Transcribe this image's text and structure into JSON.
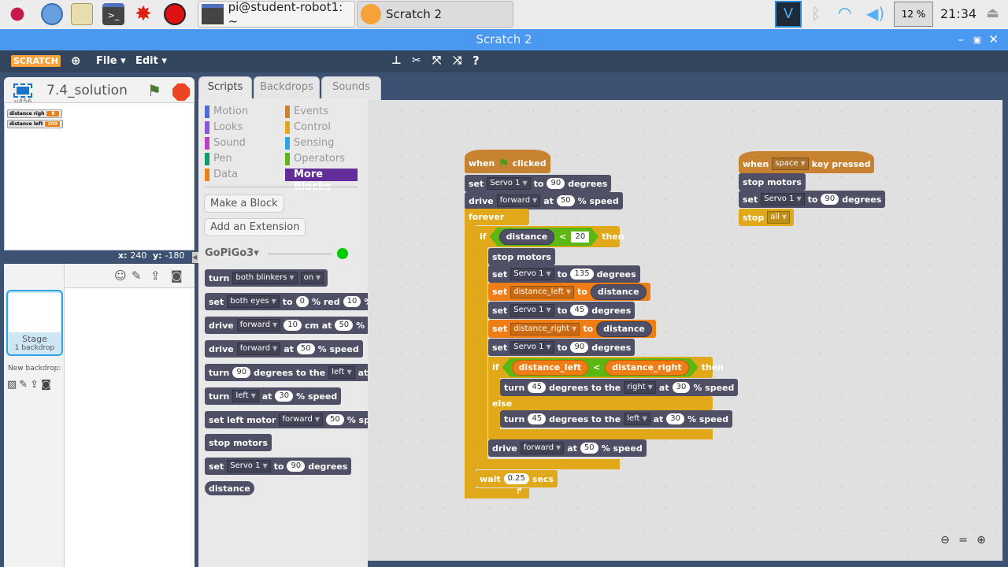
{
  "taskbar": {
    "launchers": [
      "raspberry-menu",
      "web-browser",
      "file-manager",
      "terminal",
      "mathematica",
      "wolfram"
    ],
    "tasks": [
      {
        "label": "pi@student-robot1: ~",
        "icon": "terminal-icon"
      },
      {
        "label": "Scratch 2",
        "icon": "scratch-cat-icon"
      }
    ],
    "cpu": "12 %",
    "clock": "21:34"
  },
  "window": {
    "title": "Scratch 2"
  },
  "menu": {
    "logo": "SCRATCH",
    "file": "File",
    "edit": "Edit"
  },
  "stage": {
    "project_title": "7.4_solution",
    "version": "v456",
    "monitors": [
      {
        "label": "distance righ",
        "value": "8"
      },
      {
        "label": "distance left",
        "value": "300"
      }
    ],
    "x_label": "x:",
    "x": "240",
    "y_label": "y:",
    "y": "-180"
  },
  "sprites": {
    "stage_label": "Stage",
    "backdrop_count": "1 backdrop",
    "new_backdrop": "New backdrop:"
  },
  "tabs": [
    "Scripts",
    "Backdrops",
    "Sounds"
  ],
  "categories": {
    "left": [
      {
        "label": "Motion",
        "color": "#4a6cd4"
      },
      {
        "label": "Looks",
        "color": "#8a55d7"
      },
      {
        "label": "Sound",
        "color": "#bb42c3"
      },
      {
        "label": "Pen",
        "color": "#0e9a6c"
      },
      {
        "label": "Data",
        "color": "#ee7d16"
      }
    ],
    "right": [
      {
        "label": "Events",
        "color": "#c88330"
      },
      {
        "label": "Control",
        "color": "#e1a91a"
      },
      {
        "label": "Sensing",
        "color": "#2ca5e2"
      },
      {
        "label": "Operators",
        "color": "#5cb712"
      },
      {
        "label": "More Blocks",
        "color": "#632d99",
        "selected": true
      }
    ]
  },
  "palette": {
    "make_block": "Make a Block",
    "add_extension": "Add an Extension",
    "extension_name": "GoPiGo3",
    "extension_status": "#0c0",
    "blocks": [
      {
        "cat": "gp",
        "parts": [
          {
            "text": "turn"
          },
          {
            "dropdown": "both blinkers"
          },
          {
            "dropdown": "on"
          }
        ]
      },
      {
        "cat": "gp",
        "parts": [
          {
            "text": "set"
          },
          {
            "dropdown": "both eyes"
          },
          {
            "text": "to"
          },
          {
            "input": "0"
          },
          {
            "text": "% red"
          },
          {
            "input": "10"
          },
          {
            "text": "%"
          }
        ]
      },
      {
        "cat": "gp",
        "parts": [
          {
            "text": "drive"
          },
          {
            "dropdown": "forward"
          },
          {
            "input": "10"
          },
          {
            "text": "cm at"
          },
          {
            "input": "50"
          },
          {
            "text": "% speed"
          }
        ]
      },
      {
        "cat": "gp",
        "parts": [
          {
            "text": "drive"
          },
          {
            "dropdown": "forward"
          },
          {
            "text": "at"
          },
          {
            "input": "50"
          },
          {
            "text": "% speed"
          }
        ]
      },
      {
        "cat": "gp",
        "parts": [
          {
            "text": "turn"
          },
          {
            "input": "90"
          },
          {
            "text": "degrees to the"
          },
          {
            "dropdown": "left"
          },
          {
            "text": "at"
          },
          {
            "input": "30"
          }
        ]
      },
      {
        "cat": "gp",
        "parts": [
          {
            "text": "turn"
          },
          {
            "dropdown": "left"
          },
          {
            "text": "at"
          },
          {
            "input": "30"
          },
          {
            "text": "% speed"
          }
        ]
      },
      {
        "cat": "gp",
        "parts": [
          {
            "text": "set left motor"
          },
          {
            "dropdown": "forward"
          },
          {
            "input": "50"
          },
          {
            "text": "% speed"
          }
        ]
      },
      {
        "cat": "gp",
        "parts": [
          {
            "text": "stop motors"
          }
        ]
      },
      {
        "cat": "gp",
        "parts": [
          {
            "text": "set"
          },
          {
            "dropdown": "Servo 1"
          },
          {
            "text": "to"
          },
          {
            "input": "90"
          },
          {
            "text": "degrees"
          }
        ]
      },
      {
        "cat": "gp",
        "reporter": true,
        "parts": [
          {
            "text": "distance"
          }
        ]
      }
    ]
  },
  "scripts": [
    {
      "blocks": [
        {
          "cat": "ev",
          "hat": true,
          "parts": [
            {
              "text": "when"
            },
            {
              "icon": "green-flag"
            },
            {
              "text": "clicked"
            }
          ]
        },
        {
          "cat": "gp",
          "parts": [
            {
              "text": "set"
            },
            {
              "dropdown": "Servo 1"
            },
            {
              "text": "to"
            },
            {
              "input": "90"
            },
            {
              "text": "degrees"
            }
          ]
        },
        {
          "cat": "gp",
          "parts": [
            {
              "text": "drive"
            },
            {
              "dropdown": "forward"
            },
            {
              "text": "at"
            },
            {
              "input": "50"
            },
            {
              "text": "% speed"
            }
          ]
        },
        {
          "cat": "ctl",
          "parts": [
            {
              "text": "forever"
            }
          ]
        },
        {
          "cat": "ctl",
          "parts": [
            {
              "text": "if"
            },
            {
              "boolean": [
                {
                  "reporter": "distance",
                  "kind": "gp"
                },
                {
                  "text": "<"
                },
                {
                  "input": "20"
                }
              ]
            },
            {
              "text": "then"
            }
          ]
        },
        {
          "cat": "gp",
          "parts": [
            {
              "text": "stop motors"
            }
          ]
        },
        {
          "cat": "gp",
          "parts": [
            {
              "text": "set"
            },
            {
              "dropdown": "Servo 1"
            },
            {
              "text": "to"
            },
            {
              "input": "135"
            },
            {
              "text": "degrees"
            }
          ]
        },
        {
          "cat": "var",
          "parts": [
            {
              "text": "set"
            },
            {
              "dropdown": "distance_left"
            },
            {
              "text": "to"
            },
            {
              "reporter": "distance",
              "kind": "gp"
            }
          ]
        },
        {
          "cat": "gp",
          "parts": [
            {
              "text": "set"
            },
            {
              "dropdown": "Servo 1"
            },
            {
              "text": "to"
            },
            {
              "input": "45"
            },
            {
              "text": "degrees"
            }
          ]
        },
        {
          "cat": "var",
          "parts": [
            {
              "text": "set"
            },
            {
              "dropdown": "distance_right"
            },
            {
              "text": "to"
            },
            {
              "reporter": "distance",
              "kind": "gp"
            }
          ]
        },
        {
          "cat": "gp",
          "parts": [
            {
              "text": "set"
            },
            {
              "dropdown": "Servo 1"
            },
            {
              "text": "to"
            },
            {
              "input": "90"
            },
            {
              "text": "degrees"
            }
          ]
        },
        {
          "cat": "ctl",
          "parts": [
            {
              "text": "if"
            },
            {
              "boolean": [
                {
                  "reporter": "distance_left",
                  "kind": "var"
                },
                {
                  "text": "<"
                },
                {
                  "reporter": "distance_right",
                  "kind": "var"
                }
              ]
            },
            {
              "text": "then"
            }
          ]
        },
        {
          "cat": "gp",
          "parts": [
            {
              "text": "turn"
            },
            {
              "input": "45"
            },
            {
              "text": "degrees to the"
            },
            {
              "dropdown": "right"
            },
            {
              "text": "at"
            },
            {
              "input": "30"
            },
            {
              "text": "% speed"
            }
          ]
        },
        {
          "cat": "ctl",
          "parts": [
            {
              "text": "else"
            }
          ]
        },
        {
          "cat": "gp",
          "parts": [
            {
              "text": "turn"
            },
            {
              "input": "45"
            },
            {
              "text": "degrees to the"
            },
            {
              "dropdown": "left"
            },
            {
              "text": "at"
            },
            {
              "input": "30"
            },
            {
              "text": "% speed"
            }
          ]
        },
        {
          "cat": "gp",
          "parts": [
            {
              "text": "drive"
            },
            {
              "dropdown": "forward"
            },
            {
              "text": "at"
            },
            {
              "input": "50"
            },
            {
              "text": "% speed"
            }
          ]
        },
        {
          "cat": "ctl",
          "parts": [
            {
              "text": "wait"
            },
            {
              "input": "0.25"
            },
            {
              "text": "secs"
            }
          ]
        }
      ]
    },
    {
      "blocks": [
        {
          "cat": "ev",
          "hat": true,
          "parts": [
            {
              "text": "when"
            },
            {
              "dropdown": "space"
            },
            {
              "text": "key pressed"
            }
          ]
        },
        {
          "cat": "gp",
          "parts": [
            {
              "text": "stop motors"
            }
          ]
        },
        {
          "cat": "gp",
          "parts": [
            {
              "text": "set"
            },
            {
              "dropdown": "Servo 1"
            },
            {
              "text": "to"
            },
            {
              "input": "90"
            },
            {
              "text": "degrees"
            }
          ]
        },
        {
          "cat": "ctl",
          "parts": [
            {
              "text": "stop"
            },
            {
              "dropdown": "all"
            }
          ]
        }
      ]
    }
  ]
}
